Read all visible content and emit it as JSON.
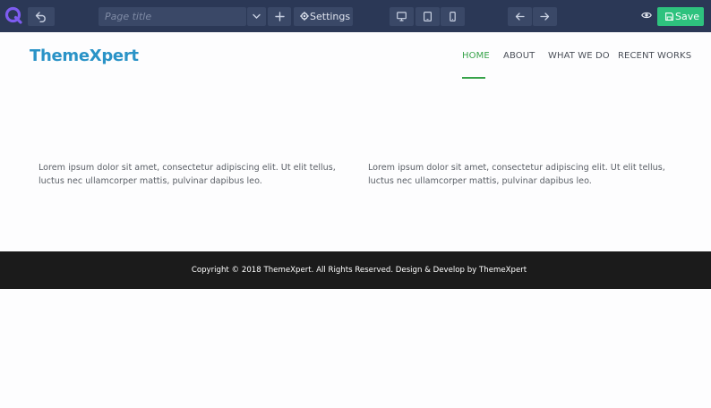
{
  "toolbar": {
    "logo_icon": "q-logo-icon",
    "undo_icon": "undo-icon",
    "page_title_placeholder": "Page title",
    "page_dropdown_icon": "chevron-down-icon",
    "add_page_icon": "plus-icon",
    "settings_label": "Settings",
    "settings_icon": "gear-icon",
    "devices": [
      "desktop-icon",
      "tablet-icon",
      "mobile-icon"
    ],
    "undo_history_icon": "arrow-left-icon",
    "redo_history_icon": "arrow-right-icon",
    "preview_icon": "eye-icon",
    "save_label": "Save",
    "save_icon": "save-icon",
    "colors": {
      "bar": "#2b3856",
      "button": "#3a4867",
      "save": "#2ec27e",
      "logo": "#7d5cf0"
    }
  },
  "site": {
    "brand": "ThemeXpert",
    "brand_color": "#2a93c7",
    "menu": [
      {
        "label": "HOME",
        "active": true
      },
      {
        "label": "ABOUT",
        "active": false
      },
      {
        "label": "WHAT WE DO",
        "active": false
      },
      {
        "label": "RECENT WORKS",
        "active": false
      }
    ],
    "accent_color": "#37a34a",
    "columns": [
      {
        "text": "Lorem ipsum dolor sit amet, consectetur adipiscing elit. Ut elit tellus, luctus nec ullamcorper mattis, pulvinar dapibus leo."
      },
      {
        "text": "Lorem ipsum dolor sit amet, consectetur adipiscing elit. Ut elit tellus, luctus nec ullamcorper mattis, pulvinar dapibus leo."
      }
    ],
    "footer": {
      "copyright": "Copyright © 2018 ThemeXpert. All Rights Reserved. Design & Develop by ThemeXpert",
      "background": "#1b1b1b"
    }
  }
}
